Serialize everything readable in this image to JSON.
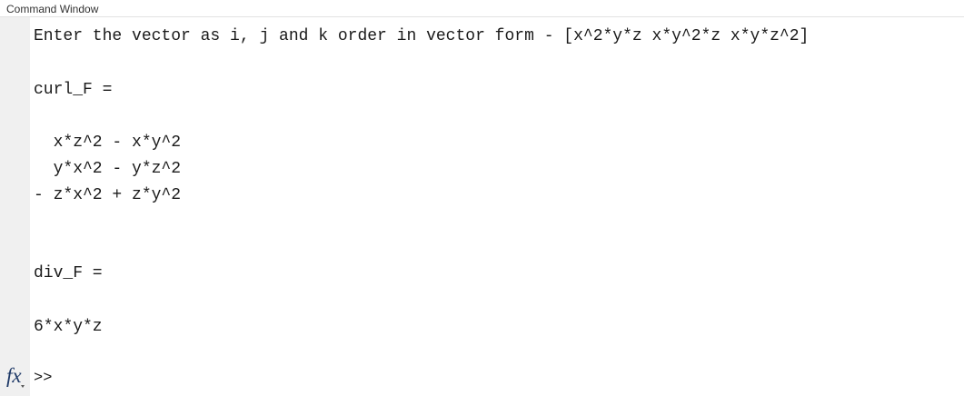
{
  "window": {
    "title": "Command Window"
  },
  "output": {
    "prompt_line": "Enter the vector as i, j and k order in vector form - [x^2*y*z x*y^2*z x*y*z^2]",
    "curl_label": "curl_F =",
    "curl_rows": [
      "  x*z^2 - x*y^2",
      "  y*x^2 - y*z^2",
      "- z*x^2 + z*y^2"
    ],
    "div_label": "div_F =",
    "div_value": "6*x*y*z"
  },
  "prompt_bar": {
    "fx_icon_text": "fx",
    "prompt_symbol": ">>"
  }
}
